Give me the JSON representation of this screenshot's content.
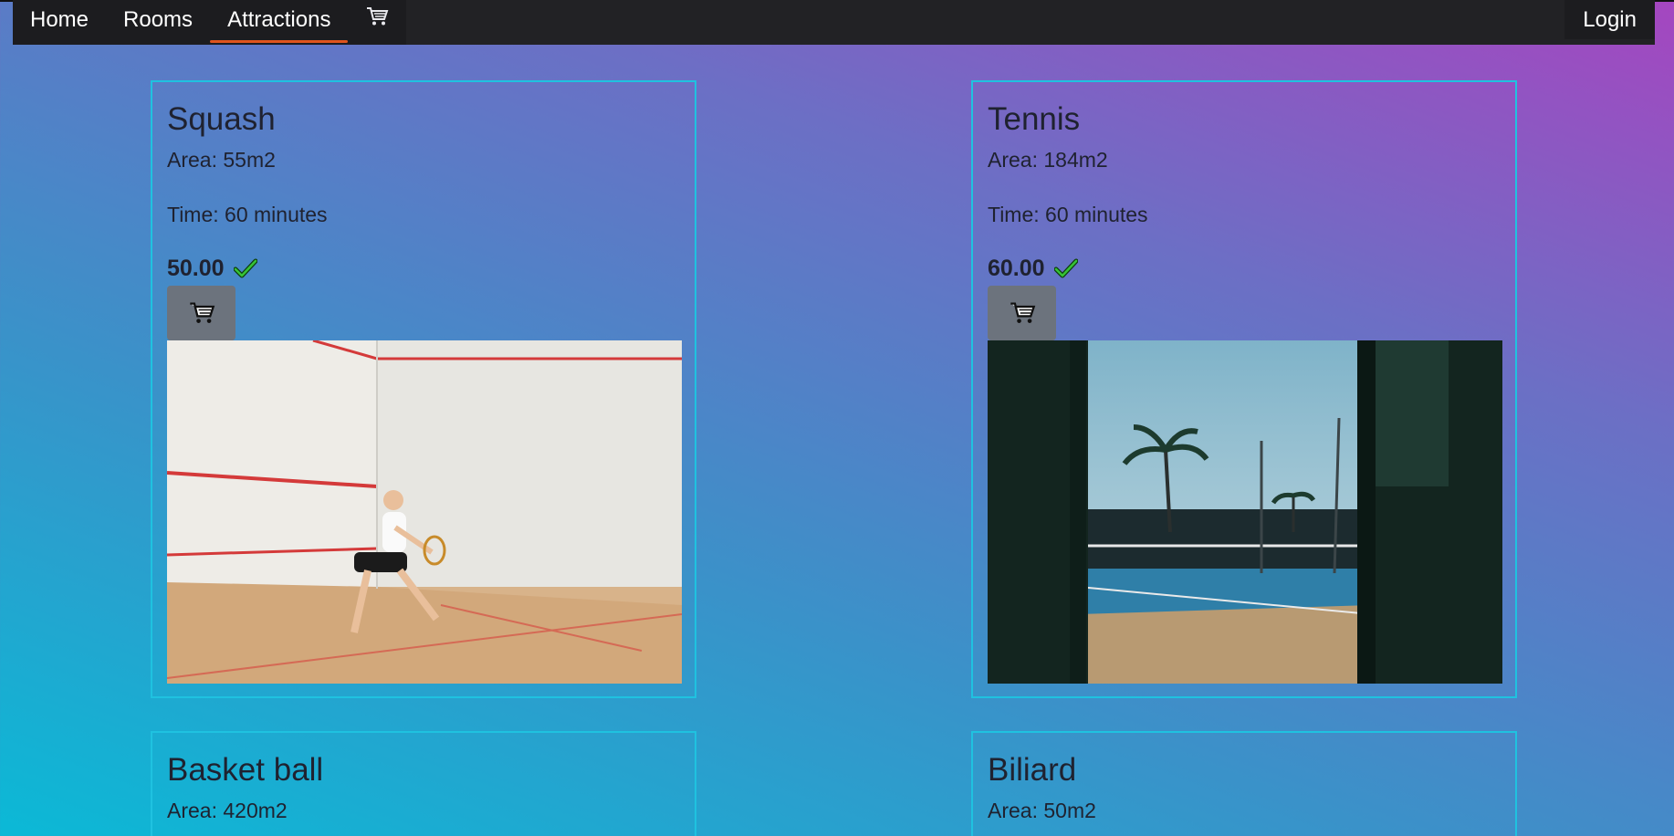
{
  "nav": {
    "home": "Home",
    "rooms": "Rooms",
    "attractions": "Attractions",
    "cart_icon": "cart-icon",
    "login": "Login"
  },
  "colors": {
    "nav_bg": "#222225",
    "active_underline": "#e0541c",
    "card_border": "#1fc2e0",
    "cart_button": "#6c737d",
    "check": "#2db82d"
  },
  "attractions": [
    {
      "name": "Squash",
      "area": "Area: 55m2",
      "time": "Time: 60 minutes",
      "price": "50.00"
    },
    {
      "name": "Tennis",
      "area": "Area: 184m2",
      "time": "Time: 60 minutes",
      "price": "60.00"
    },
    {
      "name": "Basket ball",
      "area": "Area: 420m2"
    },
    {
      "name": "Biliard",
      "area": "Area: 50m2"
    }
  ]
}
